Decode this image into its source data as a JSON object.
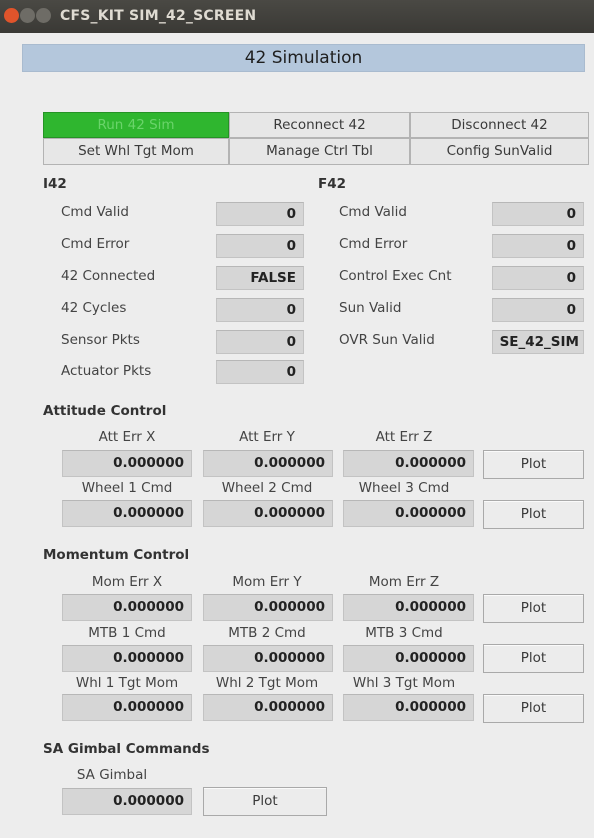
{
  "window": {
    "title": "CFS_KIT SIM_42_SCREEN"
  },
  "banner": "42 Simulation",
  "buttons": {
    "run": "Run 42 Sim",
    "reconnect": "Reconnect 42",
    "disconnect": "Disconnect 42",
    "set_whl_tgt_mom": "Set Whl Tgt Mom",
    "manage_ctrl_tbl": "Manage Ctrl Tbl",
    "config_sunvalid": "Config SunValid"
  },
  "i42": {
    "heading": "I42",
    "rows": [
      {
        "label": "Cmd Valid",
        "value": "0"
      },
      {
        "label": "Cmd Error",
        "value": "0"
      },
      {
        "label": "42 Connected",
        "value": "FALSE"
      },
      {
        "label": "42 Cycles",
        "value": "0"
      },
      {
        "label": "Sensor Pkts",
        "value": "0"
      },
      {
        "label": "Actuator Pkts",
        "value": "0"
      }
    ]
  },
  "f42": {
    "heading": "F42",
    "rows": [
      {
        "label": "Cmd Valid",
        "value": "0"
      },
      {
        "label": "Cmd Error",
        "value": "0"
      },
      {
        "label": "Control Exec Cnt",
        "value": "0"
      },
      {
        "label": "Sun Valid",
        "value": "0"
      },
      {
        "label": "OVR Sun Valid",
        "value": "SE_42_SIM"
      }
    ]
  },
  "attitude": {
    "heading": "Attitude Control",
    "groups": [
      {
        "labels": [
          "Att Err X",
          "Att Err Y",
          "Att Err Z"
        ],
        "values": [
          "0.000000",
          "0.000000",
          "0.000000"
        ],
        "plot": "Plot"
      },
      {
        "labels": [
          "Wheel 1 Cmd",
          "Wheel 2 Cmd",
          "Wheel 3 Cmd"
        ],
        "values": [
          "0.000000",
          "0.000000",
          "0.000000"
        ],
        "plot": "Plot"
      }
    ]
  },
  "momentum": {
    "heading": "Momentum Control",
    "groups": [
      {
        "labels": [
          "Mom Err X",
          "Mom Err Y",
          "Mom Err Z"
        ],
        "values": [
          "0.000000",
          "0.000000",
          "0.000000"
        ],
        "plot": "Plot"
      },
      {
        "labels": [
          "MTB 1 Cmd",
          "MTB 2 Cmd",
          "MTB 3 Cmd"
        ],
        "values": [
          "0.000000",
          "0.000000",
          "0.000000"
        ],
        "plot": "Plot"
      },
      {
        "labels": [
          "Whl 1 Tgt Mom",
          "Whl 2 Tgt Mom",
          "Whl 3 Tgt Mom"
        ],
        "values": [
          "0.000000",
          "0.000000",
          "0.000000"
        ],
        "plot": "Plot"
      }
    ]
  },
  "gimbal": {
    "heading": "SA Gimbal Commands",
    "label": "SA Gimbal",
    "value": "0.000000",
    "plot": "Plot"
  },
  "colors": {
    "run_button": "#2fb62f",
    "banner": "#b4c7dc",
    "close_button": "#e0542b",
    "title_bar": "#3d3c38"
  }
}
